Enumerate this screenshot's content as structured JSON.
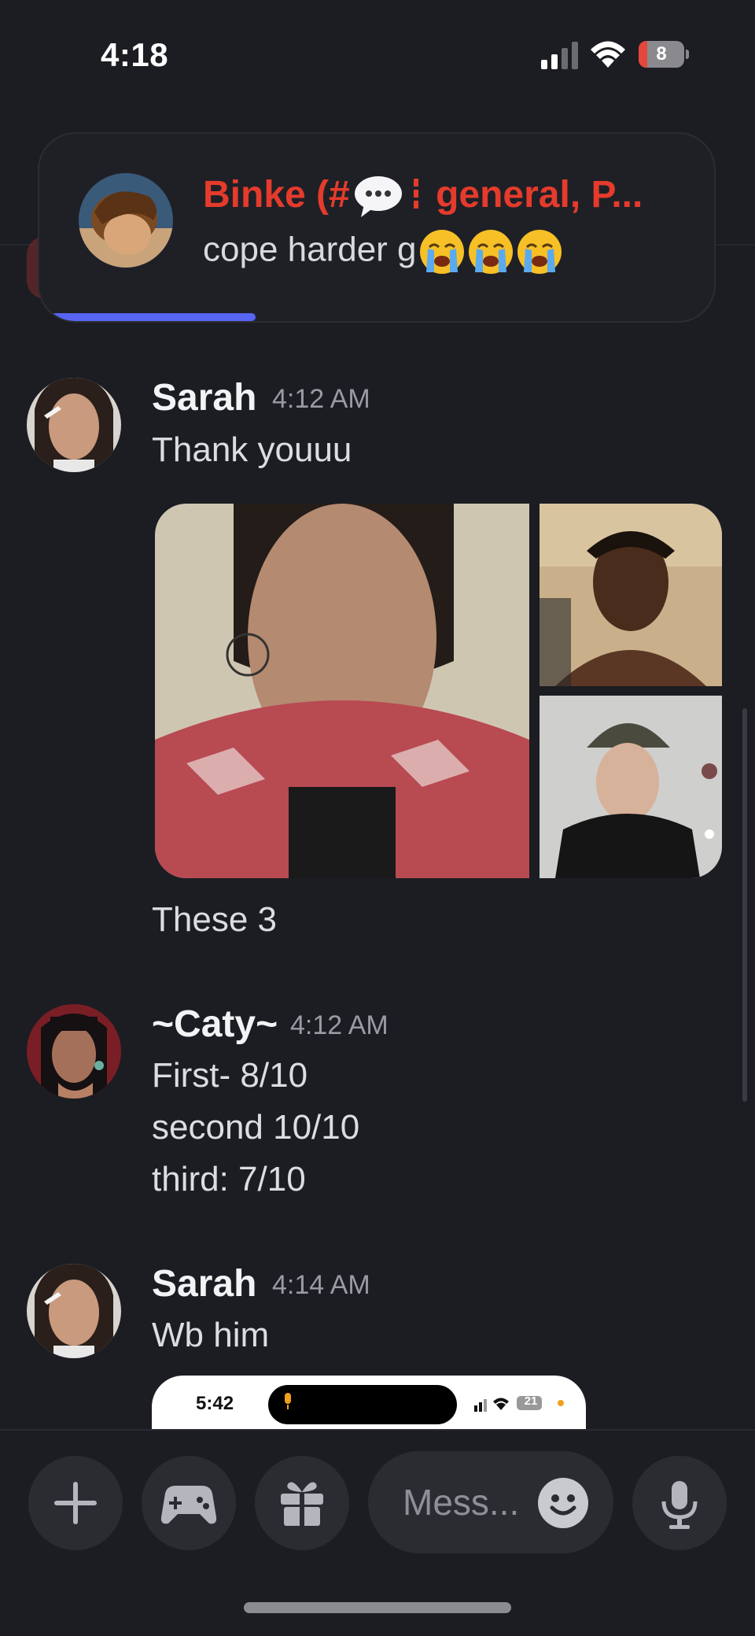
{
  "status_bar": {
    "time": "4:18",
    "battery_level": "8"
  },
  "notification": {
    "title_prefix": "Binke (#",
    "title_suffix": " general, P...",
    "body_text": "cope harder g",
    "emoji_count": 3,
    "progress_fraction": 0.32,
    "accent_color": "#5865f2"
  },
  "messages": [
    {
      "username": "Sarah",
      "timestamp": "4:12 AM",
      "lines": [
        "Thank youuu"
      ],
      "caption": "These 3"
    },
    {
      "username": "~Caty~",
      "timestamp": "4:12 AM",
      "lines": [
        "First- 8/10",
        "second 10/10",
        "third: 7/10"
      ]
    },
    {
      "username": "Sarah",
      "timestamp": "4:14 AM",
      "lines": [
        "Wb him"
      ]
    }
  ],
  "embedded_screenshot": {
    "time": "5:42",
    "battery": "21"
  },
  "composer": {
    "placeholder": "Mess..."
  },
  "icons": {
    "add": "plus-icon",
    "activities": "gamepad-icon",
    "gift": "gift-icon",
    "emoji": "emoji-icon",
    "voice": "microphone-icon"
  }
}
